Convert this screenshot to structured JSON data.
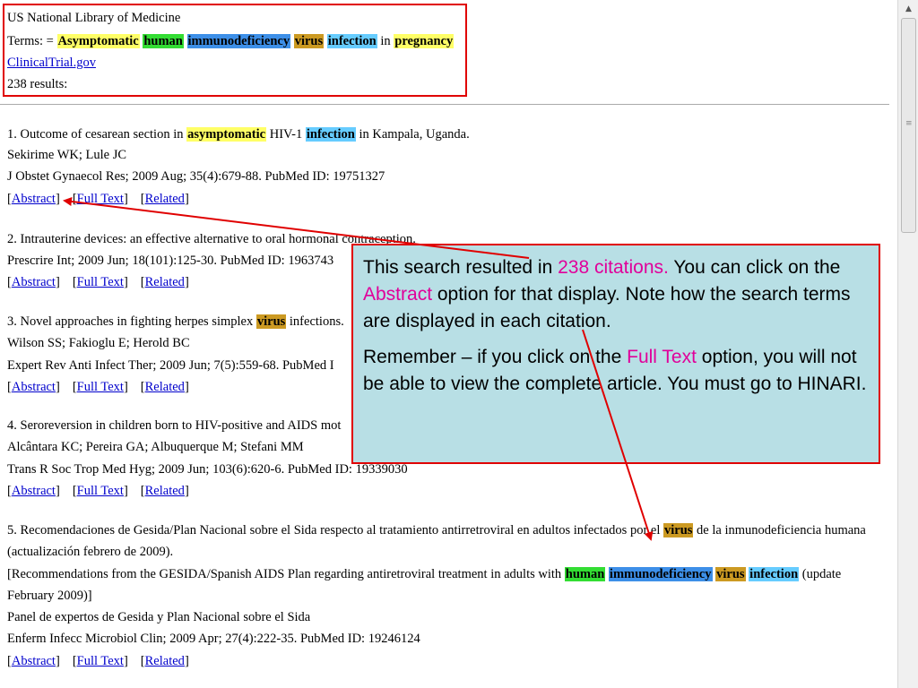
{
  "header": {
    "library": "US National Library of Medicine",
    "terms_prefix": "Terms: = ",
    "terms": [
      {
        "text": "Asymptomatic",
        "color": "#ffff66"
      },
      {
        "text": "human",
        "color": "#33dd33"
      },
      {
        "text": "immunodeficiency",
        "color": "#3d8fe8"
      },
      {
        "text": "virus",
        "color": "#cc9a22"
      },
      {
        "text": "infection",
        "color": "#66ccff"
      },
      {
        "text": "in",
        "color": null
      },
      {
        "text": "pregnancy",
        "color": "#ffff66"
      }
    ],
    "source_link": "ClinicalTrial.gov",
    "results_count": "238 results:"
  },
  "link_labels": {
    "abstract": "Abstract",
    "full_text": "Full Text",
    "related": "Related"
  },
  "results": [
    {
      "title": [
        {
          "t": "1. Outcome of cesarean section in "
        },
        {
          "t": "asymptomatic",
          "hl": "yellow"
        },
        {
          "t": " HIV-1 "
        },
        {
          "t": "infection",
          "hl": "cyan"
        },
        {
          "t": " in Kampala, Uganda."
        }
      ],
      "authors": "Sekirime WK; Lule JC",
      "citation": "J Obstet Gynaecol Res; 2009 Aug; 35(4):679-88. PubMed ID: 19751327"
    },
    {
      "title": [
        {
          "t": "2. Intrauterine devices: an effective alternative to oral hormonal contraception."
        }
      ],
      "authors": "Prescrire Int; 2009 Jun; 18(101):125-30. PubMed ID: 1963743",
      "citation": null
    },
    {
      "title": [
        {
          "t": "3. Novel approaches in fighting herpes simplex "
        },
        {
          "t": "virus",
          "hl": "gold"
        },
        {
          "t": " infections."
        }
      ],
      "authors": "Wilson SS; Fakioglu E; Herold BC",
      "citation": "Expert Rev Anti Infect Ther; 2009 Jun; 7(5):559-68. PubMed I"
    },
    {
      "title": [
        {
          "t": "4. Seroreversion in children born to HIV-positive and AIDS mot"
        }
      ],
      "authors": "Alcântara KC; Pereira GA; Albuquerque M; Stefani MM",
      "citation": "Trans R Soc Trop Med Hyg; 2009 Jun; 103(6):620-6. PubMed ID: 19339030"
    },
    {
      "title": [
        {
          "t": "5. Recomendaciones de Gesida/Plan Nacional sobre el Sida respecto al tratamiento antirretroviral en adultos infectados por el "
        },
        {
          "t": "virus",
          "hl": "gold"
        },
        {
          "t": " de la inmunodeficiencia humana"
        }
      ],
      "title_line2": "(actualización febrero de 2009).",
      "translation": [
        {
          "t": "[Recommendations from the GESIDA/Spanish AIDS Plan regarding antiretroviral treatment in adults with "
        },
        {
          "t": "human",
          "hl": "green"
        },
        {
          "t": " "
        },
        {
          "t": "immunodeficiency",
          "hl": "blue"
        },
        {
          "t": " "
        },
        {
          "t": "virus",
          "hl": "gold"
        },
        {
          "t": " "
        },
        {
          "t": "infection",
          "hl": "cyan"
        },
        {
          "t": " (update"
        }
      ],
      "translation_line2": "February 2009)]",
      "authors": "Panel de expertos de Gesida y Plan Nacional sobre el Sida",
      "citation": "Enferm Infecc Microbiol Clin; 2009 Apr; 27(4):222-35. PubMed ID: 19246124"
    }
  ],
  "callout": {
    "p1_a": "This search resulted in ",
    "p1_highlight1": "238 citations.",
    "p1_b": "  You can click on the ",
    "p1_highlight2": "Abstract",
    "p1_c": " option for that display. Note how the search terms are displayed in each citation.",
    "p2_a": "Remember – if you click on the ",
    "p2_highlight": "Full Text",
    "p2_b": " option, you will not be able to view the complete article. You must go to HINARI."
  },
  "colors": {
    "annotation_red": "#e00000",
    "callout_bg": "#b8dfe5",
    "callout_highlight": "#e0009a",
    "link": "#0000cc"
  }
}
